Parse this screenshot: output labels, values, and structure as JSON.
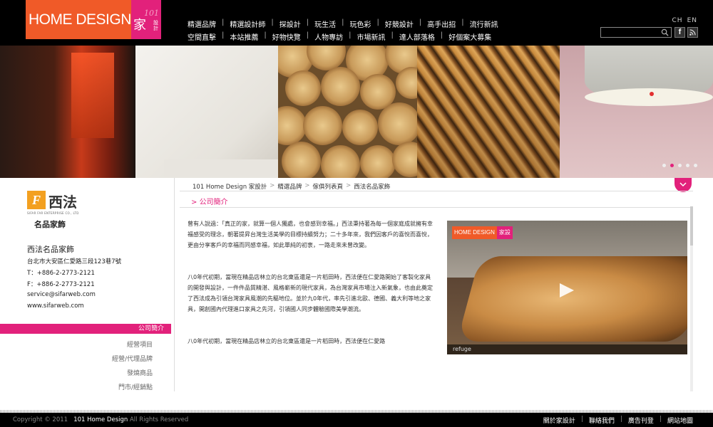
{
  "header": {
    "logo": {
      "home": "HOME",
      "design": "DESIGN",
      "number": "101",
      "jia": "家",
      "sheji": "設計"
    },
    "nav_row1": [
      "精選品牌",
      "精選設計師",
      "探設計",
      "玩生活",
      "玩色彩",
      "好競設計",
      "高手出招",
      "流行新訊"
    ],
    "nav_row2": [
      "空間直擊",
      "本站推薦",
      "好物快覽",
      "人物專訪",
      "市場新訊",
      "達人部落格",
      "好個案大募集"
    ],
    "lang": [
      "CH",
      "EN"
    ],
    "search_placeholder": ""
  },
  "banner": {
    "slide_count": 5,
    "active_slide": 1
  },
  "sidebar": {
    "brand_logo_box": "F",
    "brand_logo_cjk": "西法",
    "brand_logo_sub": "SIFAR FAR ENTERPRISE CO., LTD",
    "brand_tag": "名品家飾",
    "company_name": "西法名品家飾",
    "address": "台北市大安區仁愛路三段123巷7號",
    "tel": "T：+886-2-2773-2121",
    "fax": "F：+886-2-2773-2121",
    "email": "service@sifarweb.com",
    "website": "www.sifarweb.com",
    "menu_active": "公司簡介",
    "menu_items": [
      "經營項目",
      "經營/代理品牌",
      "發燒商品",
      "門市/經銷點"
    ]
  },
  "breadcrumb": [
    "101 Home Design 家設計",
    "精選品牌",
    "傢俱列表頁",
    "西法名品家飾"
  ],
  "section_title": "公司簡介",
  "body": {
    "p1": "曾有人說過：「真正的家，就算一個人獨處，也會感到幸福。」西法秉持著為每一個家庭成就擁有幸福感受的理念，朝著提昇台灣生活美學的目標持續努力；二十多年來，我們因客戶的喜悅而喜悅，更由分享客戶的幸福而同感幸福，如此單純的初衷，一路走來未曾改變。",
    "p2": "八0年代初期，當現在精品店林立的台北東區還是一片稻田時，西法便在仁愛路開始了客製化家具的開發與設計，一件件品質精湛、風格嶄新的現代家具，為台灣家具市場注入新氣象，也由此奠定了西法成為引領台灣家具風潮的先驅地位。並於九0年代，率先引進北歐、德國、義大利等地之家具，開創國內代理進口家具之先河，引領國人同步體驗國際美學潮流。",
    "p3": "八0年代初期，當現在精品店林立的台北東區還是一片稻田時，西法便在仁愛路"
  },
  "video": {
    "logo_left": "HOME DESIGN",
    "logo_right": "家設",
    "caption": "refuge"
  },
  "footer": {
    "copyright_prefix": "Copyright © 2011",
    "copyright_site": "101 Home Design",
    "copyright_suffix": "All Rights Reserved",
    "links": [
      "關於家設計",
      "聯絡我們",
      "廣告刊登",
      "網站地圖"
    ]
  },
  "colors": {
    "accent": "#e2217b",
    "brand_orange": "#f05a28",
    "header_bg": "#000000"
  }
}
